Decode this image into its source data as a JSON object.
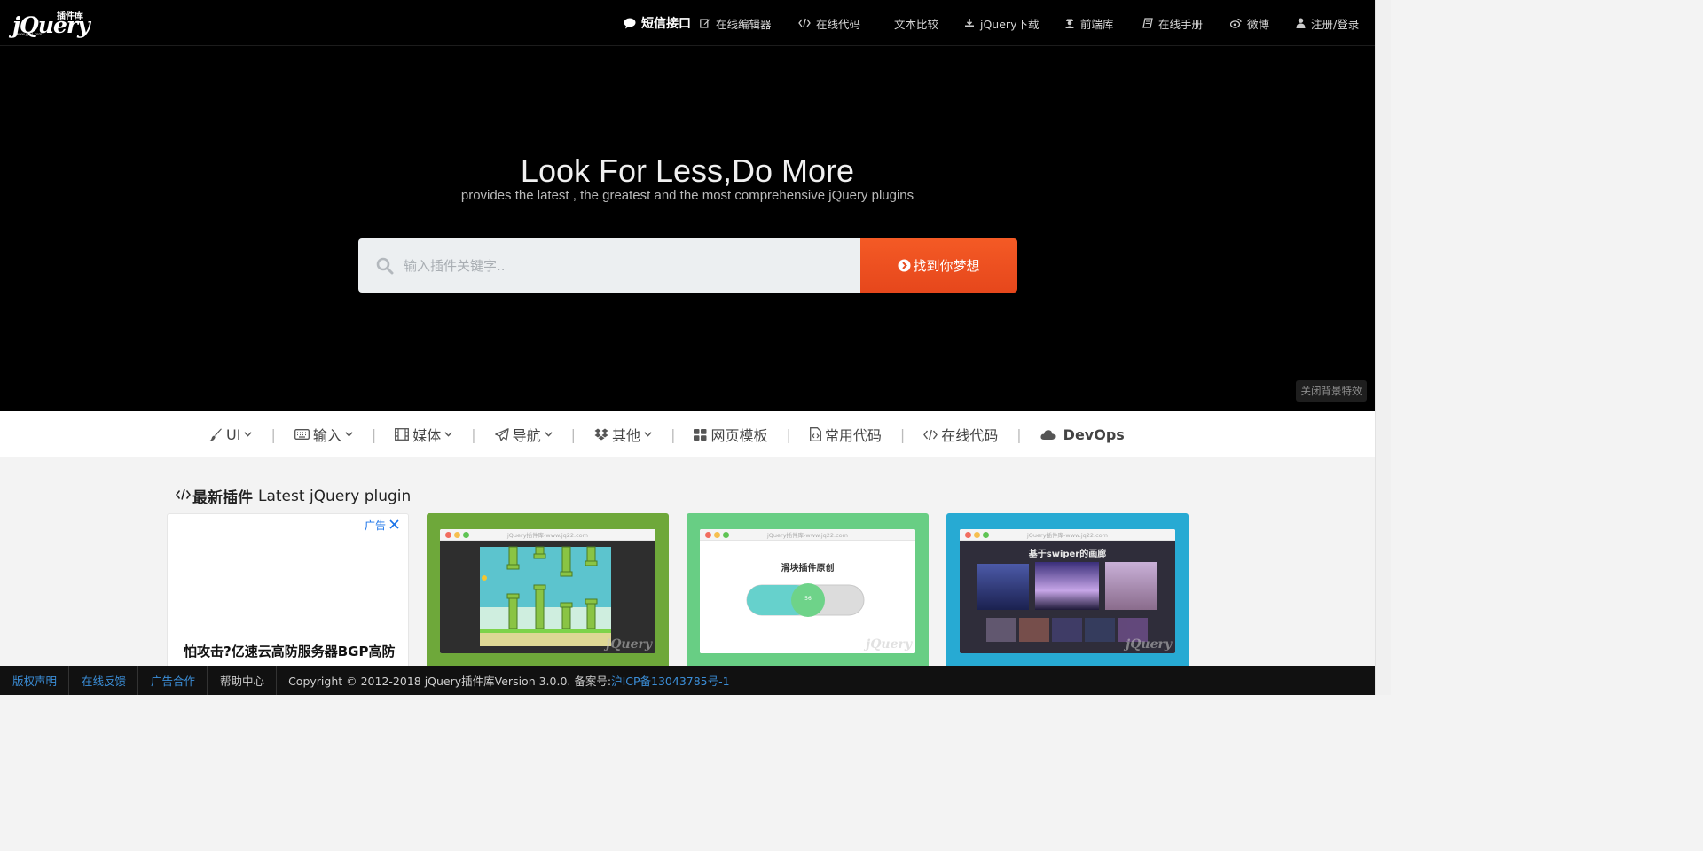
{
  "logo": {
    "word": "jQuery",
    "cn": "插件库",
    "sub": "www.jq22.com"
  },
  "nav": {
    "sms": "短信接口",
    "items": [
      {
        "label": "在线编辑器",
        "icon": "edit-icon"
      },
      {
        "label": "在线代码",
        "icon": "code-icon"
      },
      {
        "label": "文本比较",
        "icon": ""
      },
      {
        "label": "jQuery下载",
        "icon": "download-icon"
      },
      {
        "label": "前端库",
        "icon": "user-secret-icon"
      },
      {
        "label": "在线手册",
        "icon": "book-icon"
      },
      {
        "label": "微博",
        "icon": "weibo-icon"
      },
      {
        "label": "注册/登录",
        "icon": "user-icon"
      }
    ]
  },
  "hero": {
    "title": "Look For Less,Do More",
    "subtitle": "provides the latest , the greatest and the most comprehensive jQuery plugins",
    "search_placeholder": "输入插件关键字..",
    "search_button": "找到你梦想",
    "close_effect": "关闭背景特效"
  },
  "categories": [
    {
      "label": "UI",
      "icon": "paint-brush-icon",
      "dropdown": true
    },
    {
      "label": "输入",
      "icon": "keyboard-icon",
      "dropdown": true
    },
    {
      "label": "媒体",
      "icon": "film-icon",
      "dropdown": true
    },
    {
      "label": "导航",
      "icon": "paper-plane-icon",
      "dropdown": true
    },
    {
      "label": "其他",
      "icon": "dropbox-icon",
      "dropdown": true
    },
    {
      "label": "网页模板",
      "icon": "grid-icon",
      "dropdown": false
    },
    {
      "label": "常用代码",
      "icon": "file-code-icon",
      "dropdown": false
    },
    {
      "label": "在线代码",
      "icon": "code-icon",
      "dropdown": false
    },
    {
      "label": "DevOps",
      "icon": "cloud-icon",
      "dropdown": false
    }
  ],
  "latest": {
    "title_cn": "最新插件",
    "title_en": "Latest jQuery plugin",
    "ad": {
      "tag": "广告",
      "text": "怕攻击?亿速云高防服务器BGP高防"
    },
    "cards": [
      {
        "url": "jQuery插件库-www.jq22.com",
        "color": "#6ea83a"
      },
      {
        "url": "jQuery插件库-www.jq22.com",
        "color": "#68ce84",
        "caption": "滑块插件原创",
        "knob": "56"
      },
      {
        "url": "jQuery插件库-www.jq22.com",
        "color": "#27aad3",
        "caption": "基于swiper的画廊"
      }
    ]
  },
  "footer": {
    "links": [
      "版权声明",
      "在线反馈",
      "广告合作",
      "帮助中心"
    ],
    "copyright": "Copyright © 2012-2018 jQuery插件库Version 3.0.0. 备案号:",
    "icp": "沪ICP备13043785号-1"
  },
  "colors": {
    "accent": "#ee5120",
    "link": "#3b8ed8",
    "hero_bg": "#000000"
  }
}
